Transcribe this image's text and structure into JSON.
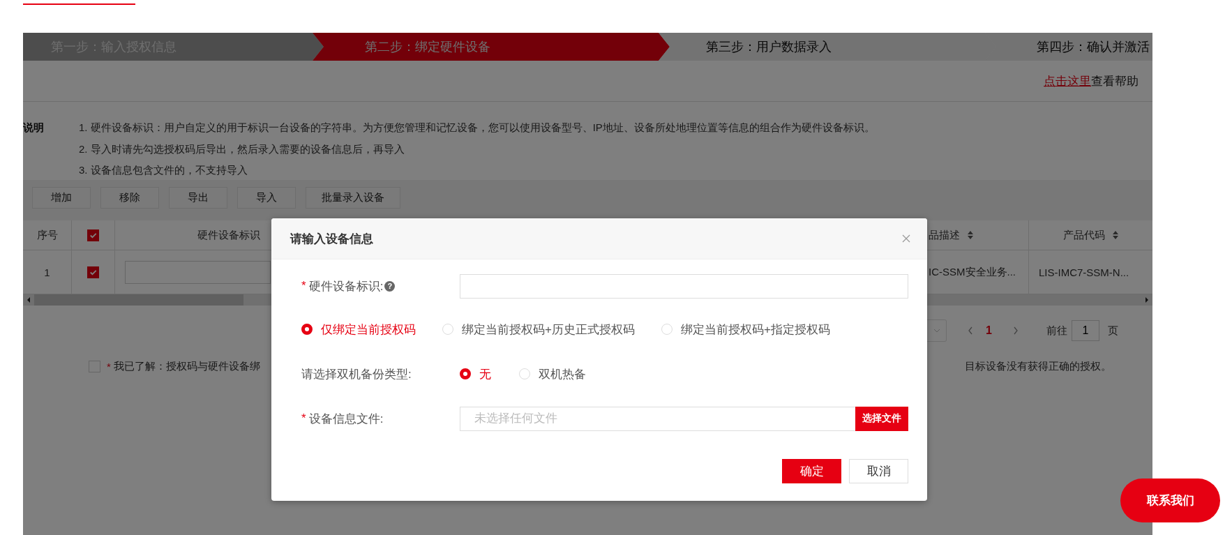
{
  "steps": [
    {
      "label": "第一步：输入授权信息",
      "selected": false,
      "done": true
    },
    {
      "label": "第二步：绑定硬件设备",
      "selected": true,
      "done": false
    },
    {
      "label": "第三步：用户数据录入",
      "selected": false,
      "done": false
    },
    {
      "label": "第四步：确认并激活",
      "selected": false,
      "done": false
    }
  ],
  "help": {
    "link": "点击这里",
    "text": "查看帮助"
  },
  "notes": {
    "title": "说明",
    "lines": [
      "1. 硬件设备标识：用户自定义的用于标识一台设备的字符串。为方便您管理和记忆设备，您可以使用设备型号、IP地址、设备所处地理位置等信息的组合作为硬件设备标识。",
      "2. 导入时请先勾选授权码后导出，然后录入需要的设备信息后，再导入",
      "3. 设备信息包含文件的，不支持导入"
    ]
  },
  "toolbar": [
    "增加",
    "移除",
    "导出",
    "导入",
    "批量录入设备"
  ],
  "table": {
    "columns": [
      {
        "kind": "index",
        "label": "序号"
      },
      {
        "kind": "check",
        "checked": true
      },
      {
        "kind": "input",
        "label": "硬件设备标识"
      },
      {
        "kind": "sortable",
        "label": "品描述"
      },
      {
        "kind": "sortable",
        "label": "产品代码"
      }
    ],
    "rows": [
      {
        "index": "1",
        "checked": true,
        "desc": "IC-SSM安全业务...",
        "code": "LIS-IMC7-SSM-N..."
      }
    ]
  },
  "pagination": {
    "page": "1",
    "goto_label": "前往",
    "goto_value": "1",
    "unit": "页"
  },
  "agreement": {
    "checked": false,
    "mark": "*",
    "text": "我已了解：授权码与硬件设备绑",
    "text_right": "目标设备没有获得正确的授权。"
  },
  "dialog": {
    "title": "请输入设备信息",
    "fields": [
      {
        "kind": "text",
        "label": "硬件设备标识:",
        "required_mark": "*",
        "help": "?"
      },
      {
        "kind": "radio",
        "options": [
          {
            "label": "仅绑定当前授权码",
            "selected": true
          },
          {
            "label": "绑定当前授权码+历史正式授权码",
            "selected": false
          },
          {
            "label": "绑定当前授权码+指定授权码",
            "selected": false
          }
        ]
      },
      {
        "kind": "radio",
        "label": "请选择双机备份类型:",
        "options": [
          {
            "label": "无",
            "selected": true
          },
          {
            "label": "双机热备",
            "selected": false
          }
        ]
      },
      {
        "kind": "file",
        "label": "设备信息文件:",
        "required_mark": "*",
        "placeholder": "未选择任何文件",
        "button": "选择文件"
      }
    ],
    "buttons": [
      {
        "label": "确定",
        "kind": "primary"
      },
      {
        "label": "取消",
        "kind": "secondary"
      }
    ]
  },
  "contact": "联系我们"
}
